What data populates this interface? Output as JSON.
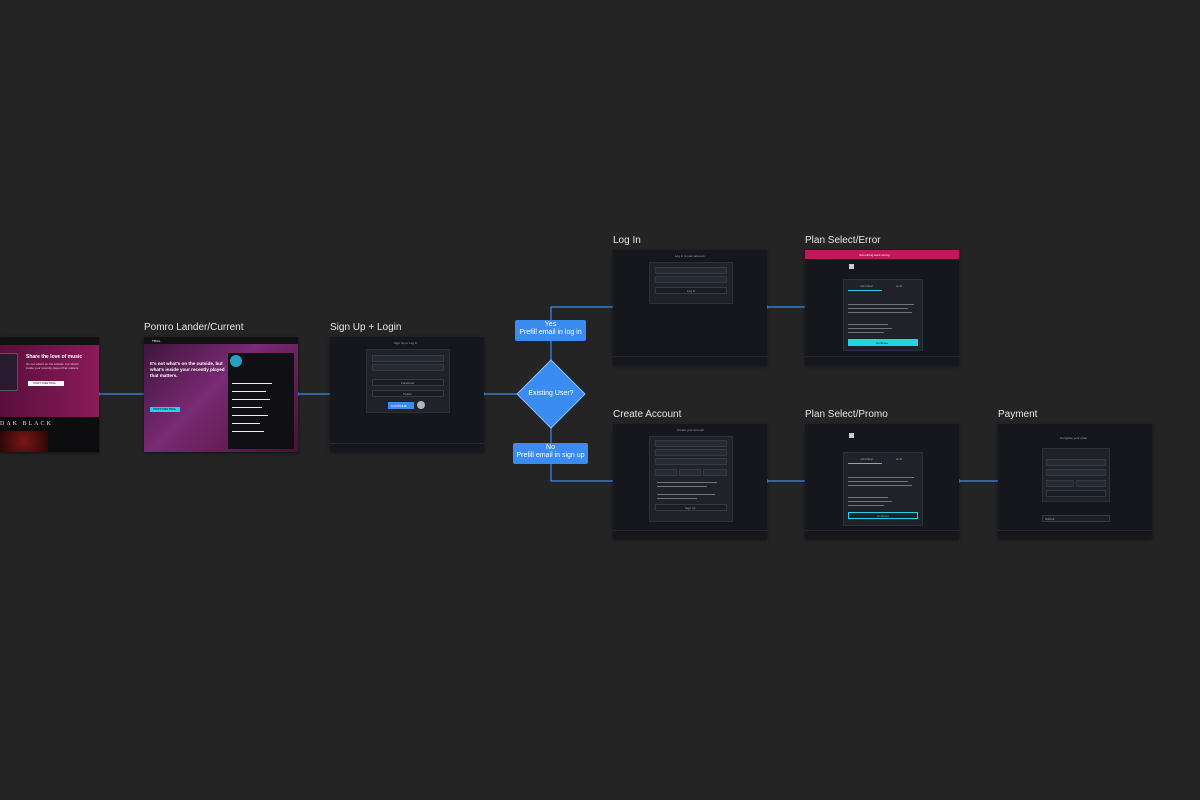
{
  "labels": {
    "pomro": "Pomro Lander/Current",
    "signup": "Sign Up + Login",
    "login": "Log In",
    "create": "Create Account",
    "plan_error": "Plan Select/Error",
    "plan_promo": "Plan Select/Promo",
    "payment": "Payment"
  },
  "decision": {
    "question": "Existing User?",
    "yes": "Yes",
    "yes_sub": "Prefill email in log in",
    "no": "No",
    "no_sub": "Prefill email in sign up"
  },
  "frames": {
    "share": {
      "headline": "Share the love of music",
      "cta": "START FREE TRIAL",
      "artist": "DAK BLACK"
    },
    "pomro": {
      "brand": "TIDAL",
      "headline": "It's not what's on the outside, but what's inside your recently played that matters.",
      "cta": "START FREE TRIAL"
    },
    "signup": {
      "title": "Sign Up or Log In",
      "btn1": "Facebook",
      "btn2": "Twitter",
      "cta": "CONTINUE"
    },
    "login": {
      "title": "Log in to your account",
      "cta": "Log In"
    },
    "create": {
      "title": "Create your account",
      "cta": "Sign Up"
    },
    "plan_error": {
      "banner": "Something went wrong"
    },
    "plan": {
      "tab1": "Individual",
      "tab2": "Hi-Fi",
      "cta": "Continue"
    },
    "payment": {
      "title": "Complete your order",
      "cta": "Submit"
    }
  },
  "colors": {
    "background": "#242424",
    "link": "#3b8cf0",
    "accent": "#24d2e6",
    "magenta": "#c2185b"
  }
}
